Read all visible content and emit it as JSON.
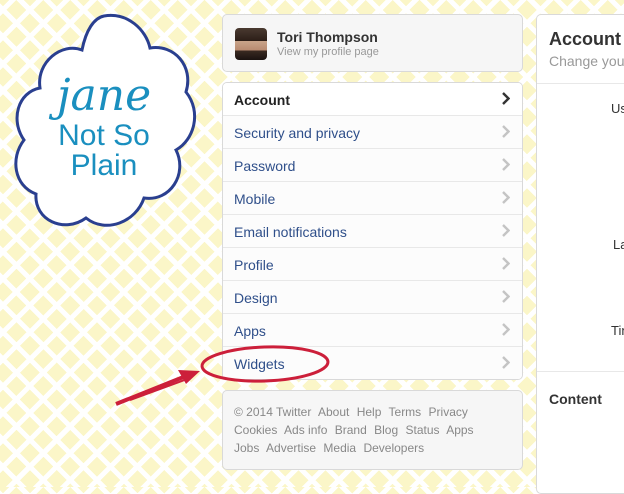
{
  "logo": {
    "line1": "jane",
    "line2": "Not So",
    "line3": "Plain"
  },
  "profile": {
    "name": "Tori Thompson",
    "link": "View my profile page"
  },
  "menu": {
    "items": [
      {
        "label": "Account"
      },
      {
        "label": "Security and privacy"
      },
      {
        "label": "Password"
      },
      {
        "label": "Mobile"
      },
      {
        "label": "Email notifications"
      },
      {
        "label": "Profile"
      },
      {
        "label": "Design"
      },
      {
        "label": "Apps"
      },
      {
        "label": "Widgets"
      }
    ]
  },
  "footer": {
    "line1": [
      "© 2014 Twitter",
      "About",
      "Help",
      "Terms",
      "Privacy"
    ],
    "line2": [
      "Cookies",
      "Ads info",
      "Brand",
      "Blog",
      "Status",
      "Apps"
    ],
    "line3": [
      "Jobs",
      "Advertise",
      "Media",
      "Developers"
    ]
  },
  "right_panel": {
    "title": "Account",
    "subtitle": "Change you",
    "label_1": "Us",
    "label_2": "La",
    "label_3": "Tin",
    "section": "Content"
  },
  "colors": {
    "accent_circle": "#cc1f3a",
    "link": "#2f4f8a",
    "logo_blue": "#1a8fbf",
    "logo_outline": "#2a3f8f"
  }
}
